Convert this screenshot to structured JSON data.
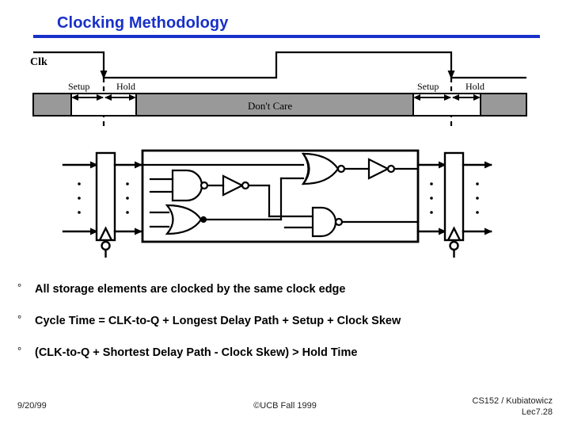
{
  "slide": {
    "title": "Clocking Methodology",
    "accent_color": "#1830c8",
    "rule_color": "#1830c8"
  },
  "timing": {
    "clk_label": "Clk",
    "dont_care_label": "Don't Care",
    "bar_color": "#999999",
    "left_setup_label": "Setup",
    "left_hold_label": "Hold",
    "right_setup_label": "Setup",
    "right_hold_label": "Hold"
  },
  "circuit": {
    "left_register_name": "storage-element-left",
    "right_register_name": "storage-element-right",
    "logic_block_name": "combinational-logic"
  },
  "bullets": [
    {
      "marker": "°",
      "text": "All storage elements are clocked by the same clock edge"
    },
    {
      "marker": "°",
      "text": "Cycle Time = CLK-to-Q + Longest Delay Path + Setup + Clock Skew"
    },
    {
      "marker": "°",
      "text": "(CLK-to-Q + Shortest Delay Path - Clock Skew)  >  Hold Time"
    }
  ],
  "footer": {
    "date": "9/20/99",
    "copyright": "©UCB Fall 1999",
    "course": "CS152 / Kubiatowicz",
    "lecture": "Lec7.28"
  }
}
